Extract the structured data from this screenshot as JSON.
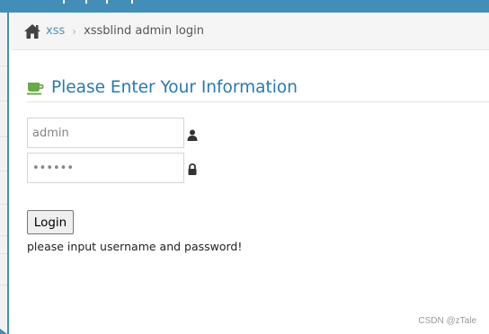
{
  "colors": {
    "accent": "#438eb9",
    "title": "#2679b5",
    "link": "#4c8fbd",
    "cup_icon": "#69aa46"
  },
  "breadcrumb": {
    "home_icon": "home-icon",
    "link": "xss",
    "separator": "›",
    "current": "xssblind admin login"
  },
  "header": {
    "icon": "coffee-cup-icon",
    "title": "Please Enter Your Information"
  },
  "form": {
    "username": {
      "value": "admin",
      "icon": "user-icon"
    },
    "password": {
      "value": "123456",
      "icon": "lock-icon"
    },
    "login_label": "Login",
    "message": "please input username and password!"
  },
  "watermark": "CSDN @zTale"
}
